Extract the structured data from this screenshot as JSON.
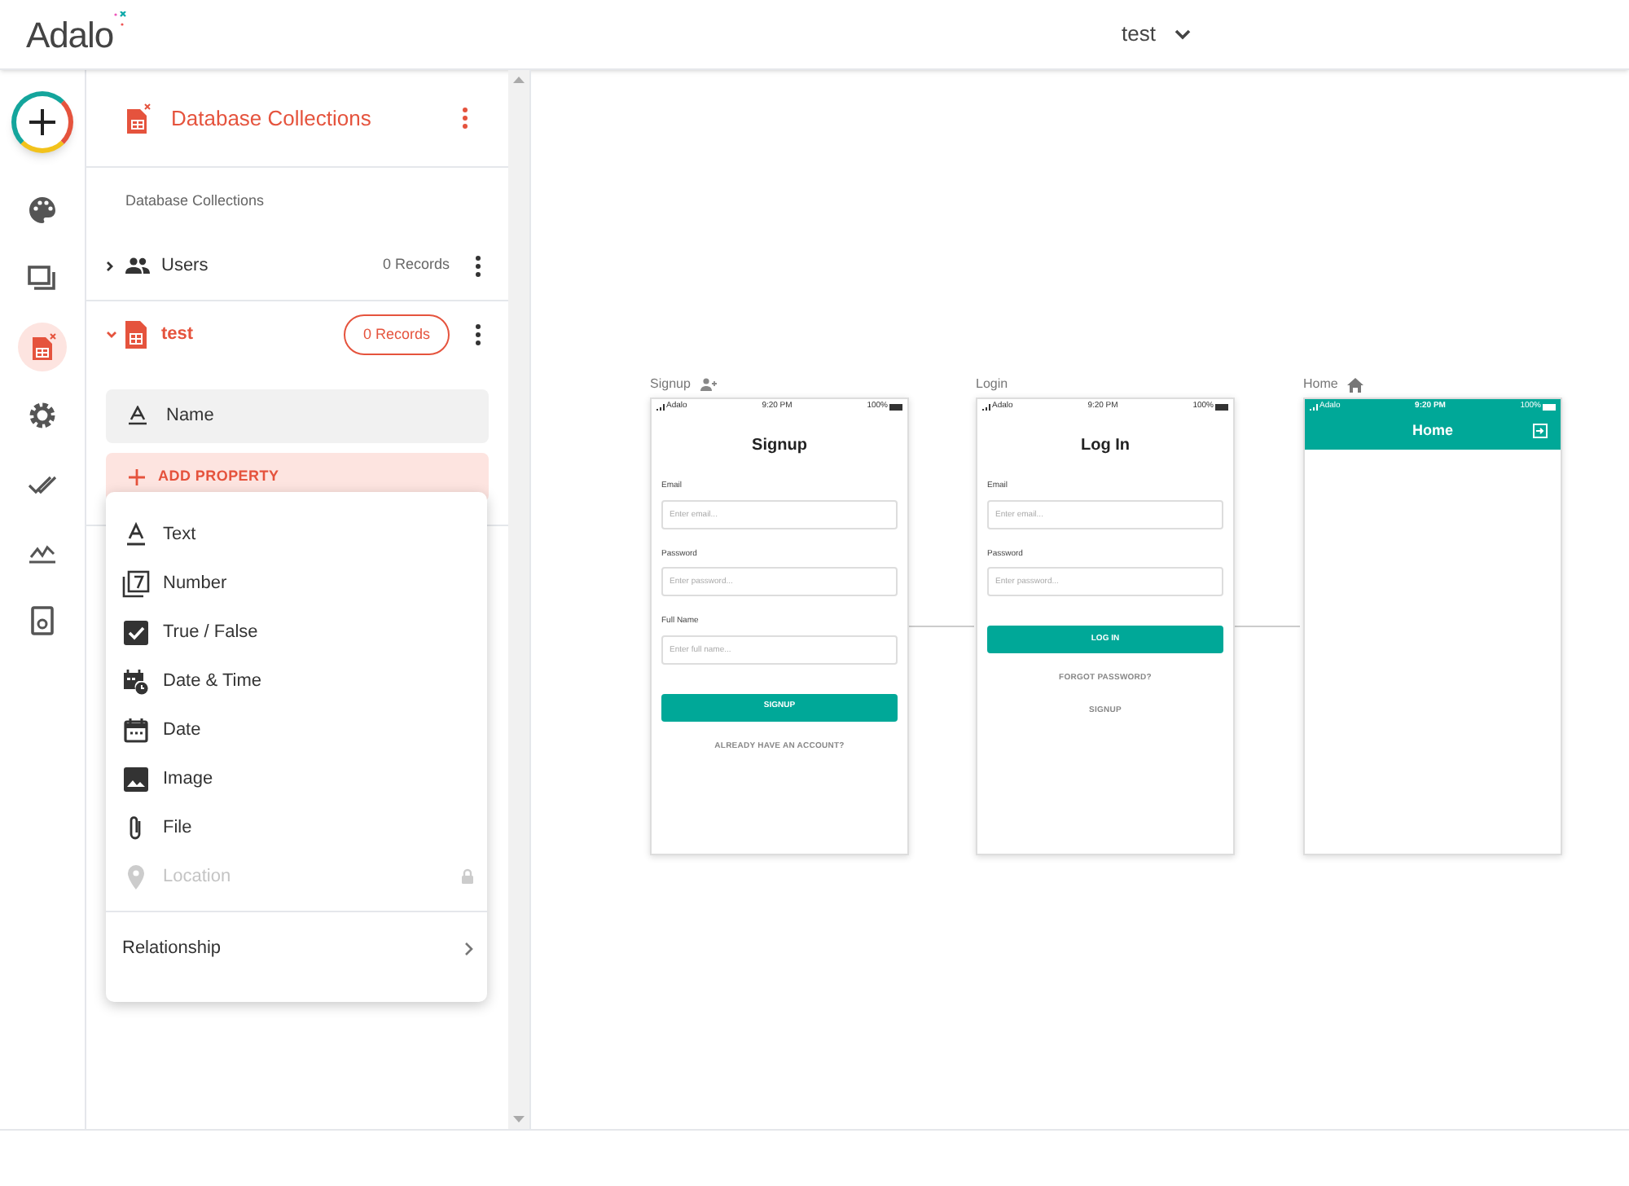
{
  "header": {
    "logo": "Adalo",
    "app_selector": "test"
  },
  "rail": {
    "items": [
      {
        "kind": "add",
        "selected": false
      },
      {
        "kind": "palette",
        "selected": false
      },
      {
        "kind": "screens",
        "selected": false
      },
      {
        "kind": "database",
        "selected": true
      },
      {
        "kind": "settings",
        "selected": false
      },
      {
        "kind": "publish",
        "selected": false
      },
      {
        "kind": "analytics",
        "selected": false
      },
      {
        "kind": "marketplace",
        "selected": false
      }
    ]
  },
  "panel": {
    "title": "Database Collections",
    "section_label": "Database Collections",
    "collections": [
      {
        "kind": "users",
        "name": "Users",
        "records": "0 Records",
        "expanded": false
      },
      {
        "kind": "table",
        "name": "test",
        "records": "0 Records",
        "expanded": true,
        "properties": [
          {
            "name": "Name"
          }
        ]
      }
    ],
    "add_property": "ADD PROPERTY"
  },
  "menu": {
    "items": [
      {
        "kind": "text",
        "label": "Text",
        "disabled": false
      },
      {
        "kind": "number",
        "label": "Number",
        "disabled": false
      },
      {
        "kind": "boolean",
        "label": "True / False",
        "disabled": false
      },
      {
        "kind": "datetime",
        "label": "Date & Time",
        "disabled": false
      },
      {
        "kind": "date",
        "label": "Date",
        "disabled": false
      },
      {
        "kind": "image",
        "label": "Image",
        "disabled": false
      },
      {
        "kind": "file",
        "label": "File",
        "disabled": false
      },
      {
        "kind": "location",
        "label": "Location",
        "disabled": true
      }
    ],
    "submenu": "Relationship"
  },
  "screens": [
    {
      "label": "Signup",
      "kind": "user",
      "carrier": "Adalo",
      "time": "9:20 PM",
      "battery": "100%",
      "app_bar": false,
      "title": "Signup",
      "fields": [
        {
          "label": "Email",
          "placeholder": "Enter email..."
        },
        {
          "label": "Password",
          "placeholder": "Enter password..."
        },
        {
          "label": "Full Name",
          "placeholder": "Enter full name..."
        }
      ],
      "button": "SIGNUP",
      "links": [
        "ALREADY HAVE AN ACCOUNT?"
      ]
    },
    {
      "label": "Login",
      "kind": "plain",
      "carrier": "Adalo",
      "time": "9:20 PM",
      "battery": "100%",
      "app_bar": false,
      "title": "Log In",
      "fields": [
        {
          "label": "Email",
          "placeholder": "Enter email..."
        },
        {
          "label": "Password",
          "placeholder": "Enter password..."
        }
      ],
      "button": "LOG IN",
      "links": [
        "FORGOT PASSWORD?",
        "SIGNUP"
      ]
    },
    {
      "label": "Home",
      "kind": "home",
      "carrier": "Adalo",
      "time": "9:20 PM",
      "battery": "100%",
      "app_bar": true,
      "title": "Home"
    }
  ]
}
